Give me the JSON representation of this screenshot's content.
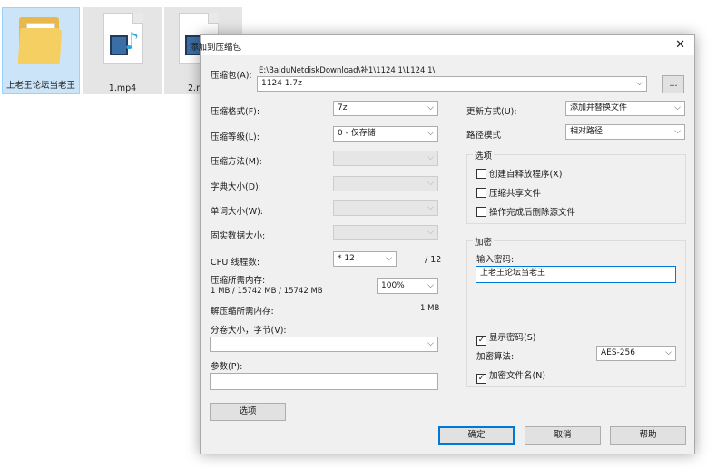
{
  "desktop": {
    "icons": [
      {
        "label": "上老王论坛当老王"
      },
      {
        "label": "1.mp4"
      },
      {
        "label": "2.r"
      }
    ]
  },
  "dialog": {
    "title": "添加到压缩包",
    "archive_label": "压缩包(A):",
    "archive_path": "E:\\BaiduNetdiskDownload\\补1\\1124 1\\1124 1\\",
    "archive_name": "1124 1.7z",
    "browse_label": "...",
    "left": {
      "format_label": "压缩格式(F):",
      "format_value": "7z",
      "level_label": "压缩等级(L):",
      "level_value": "0 - 仅存储",
      "method_label": "压缩方法(M):",
      "dict_label": "字典大小(D):",
      "word_label": "单词大小(W):",
      "solid_label": "固实数据大小:",
      "cpu_label": "CPU 线程数:",
      "cpu_value": "* 12",
      "cpu_max": "/ 12",
      "mem_label": "压缩所需内存:",
      "mem_value": "1 MB / 15742 MB / 15742 MB",
      "mem_percent": "100%",
      "decomp_label": "解压缩所需内存:",
      "decomp_value": "1 MB",
      "split_label": "分卷大小，字节(V):",
      "params_label": "参数(P):",
      "options_button": "选项"
    },
    "right": {
      "update_label": "更新方式(U):",
      "update_value": "添加并替换文件",
      "pathmode_label": "路径模式",
      "pathmode_value": "相对路径",
      "options_group": "选项",
      "opt_sfx": "创建自释放程序(X)",
      "opt_shared": "压缩共享文件",
      "opt_delete": "操作完成后删除源文件",
      "encrypt_group": "加密",
      "password_label": "输入密码:",
      "password_value": "上老王论坛当老王",
      "show_password": "显示密码(S)",
      "enc_method_label": "加密算法:",
      "enc_method_value": "AES-256",
      "encrypt_names": "加密文件名(N)"
    },
    "buttons": {
      "ok": "确定",
      "cancel": "取消",
      "help": "帮助"
    },
    "checkmark": "✓",
    "close_glyph": "✕",
    "arrow_glyph": "⌵"
  }
}
